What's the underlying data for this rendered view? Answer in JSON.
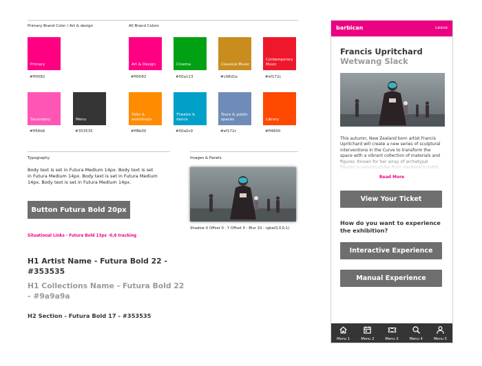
{
  "styleguide": {
    "primary_label": "Primary Brand Color / Art & design",
    "all_label": "All Brand Colors",
    "typography_label": "Typography",
    "images_label": "Images & Panels",
    "primary_swatches": [
      {
        "name": "Primary",
        "hex": "#ff0082",
        "color": "#ff0082"
      },
      {
        "name": "Secondary",
        "hex": "#ff56b6",
        "color": "#ff56b6"
      },
      {
        "name": "Menu",
        "hex": "#353535",
        "color": "#353535"
      }
    ],
    "brand_swatches": [
      {
        "name": "Art & Design",
        "hex": "#ff0082",
        "color": "#ff0082"
      },
      {
        "name": "Cinema",
        "hex": "#00a113",
        "color": "#00a113"
      },
      {
        "name": "Classical Music",
        "hex": "#c98d1e",
        "color": "#c98d1e"
      },
      {
        "name": "Contemporary Music",
        "hex": "#ef172c",
        "color": "#ef172c"
      },
      {
        "name": "Talks & workshops",
        "hex": "#ff8b00",
        "color": "#ff8b00"
      },
      {
        "name": "Theatre & dance",
        "hex": "#00a0c9",
        "color": "#00a0c9"
      },
      {
        "name": "Tours & public spaces",
        "hex": "#ef172c",
        "color": "#6f8cb8"
      },
      {
        "name": "Library",
        "hex": "#ff4800",
        "color": "#ff4800"
      }
    ],
    "body_text": "Body text is set in Futura Medium 14px. Body text is set in Futura Medium 14px. Body text is set in Futura Medium 14px. Body text is set in Futura Medium 14px.",
    "button_label": "Button Futura Bold 20px",
    "situational_link": "Situational Links - Futura Bold 13px -0,6 tracking",
    "h1_artist": "H1 Artist Name - Futura Bold 22 - #353535",
    "h1_collection": "H1 Collections Name - Futura Bold 22 - #9a9a9a",
    "h2_section": "H2 Section - Futura Bold 17 - #353535",
    "shadow_caption": "Shadow X Offset 0 - Y Offset 0 - Blur 10 - rgba(0,0,0,1)"
  },
  "phone": {
    "brand": "barbican",
    "leave": "Leave",
    "artist": "Francis Upritchard",
    "collection": "Wetwang Slack",
    "body": "This autumn, New Zealand born artist Francis Upritchard will create a new series of sculptural interventions in the Curve to transform the space with a vibrant collection of materials and figures. Known for her array of archetypal figures in varying styles from medieval knights to meditating monks.",
    "read_more": "Read More",
    "view_ticket": "View Your Ticket",
    "question": "How do you want to experience the exhibition?",
    "interactive": "Interactive Experience",
    "manual": "Manual Experience",
    "nav": [
      {
        "label": "Menu 1",
        "icon": "home-icon"
      },
      {
        "label": "Menu 2",
        "icon": "calendar-icon"
      },
      {
        "label": "Menu 3",
        "icon": "ticket-icon"
      },
      {
        "label": "Menu 4",
        "icon": "search-icon"
      },
      {
        "label": "Menu 5",
        "icon": "user-icon"
      }
    ]
  },
  "colors": {
    "accent": "#ec0082",
    "menu": "#353535",
    "button": "#6e6e6e",
    "muted": "#9a9a9a"
  }
}
